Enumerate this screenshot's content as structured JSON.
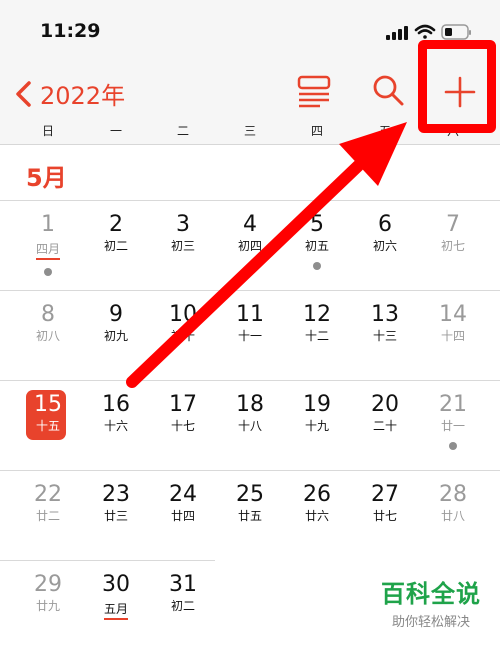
{
  "status_bar": {
    "time": "11:29"
  },
  "nav": {
    "year_label": "2022年"
  },
  "weekdays": [
    "日",
    "一",
    "二",
    "三",
    "四",
    "五",
    "六"
  ],
  "month_title": "5月",
  "days": [
    {
      "n": "1",
      "l": "四月"
    },
    {
      "n": "2",
      "l": "初二"
    },
    {
      "n": "3",
      "l": "初三"
    },
    {
      "n": "4",
      "l": "初四"
    },
    {
      "n": "5",
      "l": "初五"
    },
    {
      "n": "6",
      "l": "初六"
    },
    {
      "n": "7",
      "l": "初七"
    },
    {
      "n": "8",
      "l": "初八"
    },
    {
      "n": "9",
      "l": "初九"
    },
    {
      "n": "10",
      "l": "初十"
    },
    {
      "n": "11",
      "l": "十一"
    },
    {
      "n": "12",
      "l": "十二"
    },
    {
      "n": "13",
      "l": "十三"
    },
    {
      "n": "14",
      "l": "十四"
    },
    {
      "n": "15",
      "l": "十五"
    },
    {
      "n": "16",
      "l": "十六"
    },
    {
      "n": "17",
      "l": "十七"
    },
    {
      "n": "18",
      "l": "十八"
    },
    {
      "n": "19",
      "l": "十九"
    },
    {
      "n": "20",
      "l": "二十"
    },
    {
      "n": "21",
      "l": "廿一"
    },
    {
      "n": "22",
      "l": "廿二"
    },
    {
      "n": "23",
      "l": "廿三"
    },
    {
      "n": "24",
      "l": "廿四"
    },
    {
      "n": "25",
      "l": "廿五"
    },
    {
      "n": "26",
      "l": "廿六"
    },
    {
      "n": "27",
      "l": "廿七"
    },
    {
      "n": "28",
      "l": "廿八"
    },
    {
      "n": "29",
      "l": "廿九"
    },
    {
      "n": "30",
      "l": "五月"
    },
    {
      "n": "31",
      "l": "初二"
    }
  ],
  "watermark": {
    "main": "百科全说",
    "sub": "助你轻松解决"
  },
  "colors": {
    "accent": "#e8432c",
    "annotation": "#ff0000",
    "watermark": "#1fa34a"
  },
  "icons": {
    "back": "chevron-left-icon",
    "view": "list-view-icon",
    "search": "search-icon",
    "add": "plus-icon"
  }
}
